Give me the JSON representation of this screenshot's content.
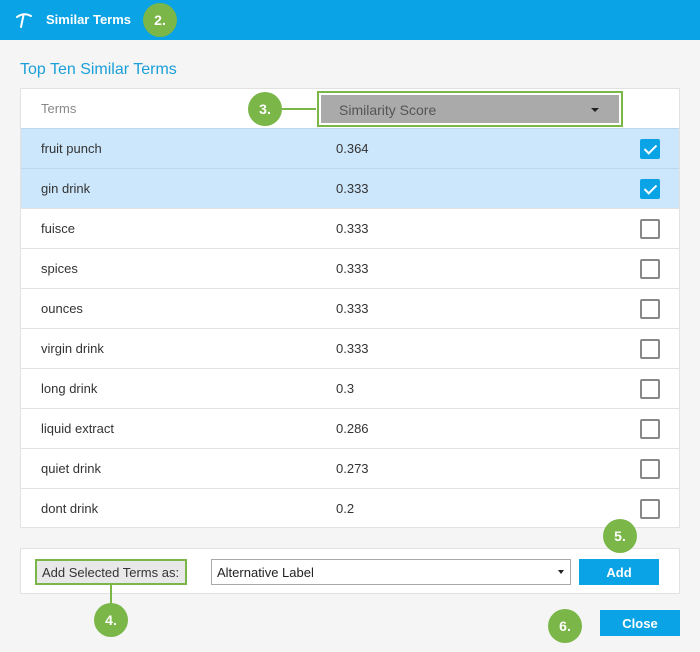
{
  "window": {
    "title": "Similar Terms",
    "icon": "pickaxe-icon"
  },
  "callouts": {
    "title": "2.",
    "sort": "3.",
    "add_label": "4.",
    "add_button": "5.",
    "close_button": "6."
  },
  "section_title": "Top Ten Similar Terms",
  "table": {
    "columns": {
      "terms": "Terms",
      "score": "Similarity Score"
    },
    "rows": [
      {
        "term": "fruit punch",
        "score": "0.364",
        "checked": true
      },
      {
        "term": "gin drink",
        "score": "0.333",
        "checked": true
      },
      {
        "term": "fuisce",
        "score": "0.333",
        "checked": false
      },
      {
        "term": "spices",
        "score": "0.333",
        "checked": false
      },
      {
        "term": "ounces",
        "score": "0.333",
        "checked": false
      },
      {
        "term": "virgin drink",
        "score": "0.333",
        "checked": false
      },
      {
        "term": "long drink",
        "score": "0.3",
        "checked": false
      },
      {
        "term": "liquid extract",
        "score": "0.286",
        "checked": false
      },
      {
        "term": "quiet drink",
        "score": "0.273",
        "checked": false
      },
      {
        "term": "dont drink",
        "score": "0.2",
        "checked": false
      }
    ]
  },
  "add_bar": {
    "label": "Add Selected Terms as:",
    "selected_option": "Alternative Label",
    "add_button": "Add"
  },
  "close_button": "Close",
  "colors": {
    "accent": "#0aa3e6",
    "callout": "#7ab648",
    "selected_row": "#cce6fb"
  }
}
